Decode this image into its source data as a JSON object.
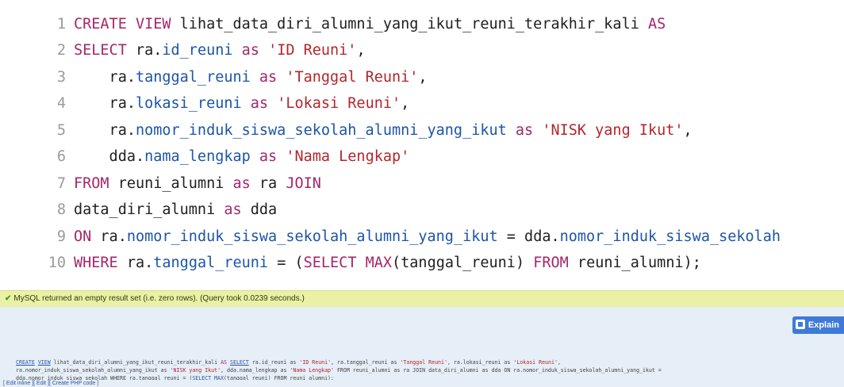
{
  "editor": {
    "lines": [
      {
        "num": "1",
        "tokens": [
          {
            "t": "kw",
            "v": "CREATE VIEW"
          },
          {
            "t": "plain",
            "v": " lihat_data_diri_alumni_yang_ikut_reuni_terakhir_kali "
          },
          {
            "t": "kw",
            "v": "AS"
          }
        ]
      },
      {
        "num": "2",
        "tokens": [
          {
            "t": "kw",
            "v": "SELECT"
          },
          {
            "t": "plain",
            "v": " ra."
          },
          {
            "t": "fld",
            "v": "id_reuni"
          },
          {
            "t": "kw",
            "v": " as "
          },
          {
            "t": "str",
            "v": "'ID Reuni'"
          },
          {
            "t": "plain",
            "v": ","
          }
        ]
      },
      {
        "num": "3",
        "tokens": [
          {
            "t": "plain",
            "v": "    ra."
          },
          {
            "t": "fld",
            "v": "tanggal_reuni"
          },
          {
            "t": "kw",
            "v": " as "
          },
          {
            "t": "str",
            "v": "'Tanggal Reuni'"
          },
          {
            "t": "plain",
            "v": ","
          }
        ]
      },
      {
        "num": "4",
        "tokens": [
          {
            "t": "plain",
            "v": "    ra."
          },
          {
            "t": "fld",
            "v": "lokasi_reuni"
          },
          {
            "t": "kw",
            "v": " as "
          },
          {
            "t": "str",
            "v": "'Lokasi Reuni'"
          },
          {
            "t": "plain",
            "v": ","
          }
        ]
      },
      {
        "num": "5",
        "tokens": [
          {
            "t": "plain",
            "v": "    ra."
          },
          {
            "t": "fld",
            "v": "nomor_induk_siswa_sekolah_alumni_yang_ikut"
          },
          {
            "t": "kw",
            "v": " as "
          },
          {
            "t": "str",
            "v": "'NISK yang Ikut'"
          },
          {
            "t": "plain",
            "v": ","
          }
        ]
      },
      {
        "num": "6",
        "tokens": [
          {
            "t": "plain",
            "v": "    dda."
          },
          {
            "t": "fld",
            "v": "nama_lengkap"
          },
          {
            "t": "kw",
            "v": " as "
          },
          {
            "t": "str",
            "v": "'Nama Lengkap'"
          }
        ]
      },
      {
        "num": "7",
        "tokens": [
          {
            "t": "kw",
            "v": "FROM"
          },
          {
            "t": "plain",
            "v": " reuni_alumni "
          },
          {
            "t": "kw",
            "v": "as"
          },
          {
            "t": "plain",
            "v": " ra "
          },
          {
            "t": "kw",
            "v": "JOIN"
          }
        ]
      },
      {
        "num": "8",
        "tokens": [
          {
            "t": "plain",
            "v": "data_diri_alumni "
          },
          {
            "t": "kw",
            "v": "as"
          },
          {
            "t": "plain",
            "v": " dda"
          }
        ]
      },
      {
        "num": "9",
        "tokens": [
          {
            "t": "kw",
            "v": "ON"
          },
          {
            "t": "plain",
            "v": " ra."
          },
          {
            "t": "fld",
            "v": "nomor_induk_siswa_sekolah_alumni_yang_ikut"
          },
          {
            "t": "plain",
            "v": " = dda."
          },
          {
            "t": "fld",
            "v": "nomor_induk_siswa_sekolah"
          }
        ]
      },
      {
        "num": "10",
        "tokens": [
          {
            "t": "kw",
            "v": "WHERE"
          },
          {
            "t": "plain",
            "v": " ra."
          },
          {
            "t": "fld",
            "v": "tanggal_reuni"
          },
          {
            "t": "plain",
            "v": " = ("
          },
          {
            "t": "kw",
            "v": "SELECT MAX"
          },
          {
            "t": "plain",
            "v": "(tanggal_reuni) "
          },
          {
            "t": "kw",
            "v": "FROM"
          },
          {
            "t": "plain",
            "v": " reuni_alumni);"
          }
        ]
      }
    ]
  },
  "status": {
    "message": "MySQL returned an empty result set (i.e. zero rows). (Query took 0.0239 seconds.)"
  },
  "result": {
    "explain_label": "Explain",
    "echo_lines": [
      [
        {
          "t": "a",
          "v": "CREATE"
        },
        {
          "t": "p",
          "v": " "
        },
        {
          "t": "a",
          "v": "VIEW"
        },
        {
          "t": "p",
          "v": " lihat_data_diri_alumni_yang_ikut_reuni_terakhir_kali "
        },
        {
          "t": "k",
          "v": "AS"
        },
        {
          "t": "p",
          "v": " "
        },
        {
          "t": "a",
          "v": "SELECT"
        },
        {
          "t": "p",
          "v": " ra.id_reuni as "
        },
        {
          "t": "s",
          "v": "'ID Reuni'"
        },
        {
          "t": "p",
          "v": ", ra.tanggal_reuni as "
        },
        {
          "t": "s",
          "v": "'Tanggal Reuni'"
        },
        {
          "t": "p",
          "v": ", ra.lokasi_reuni as "
        },
        {
          "t": "s",
          "v": "'Lokasi Reuni'"
        },
        {
          "t": "p",
          "v": ","
        }
      ],
      [
        {
          "t": "p",
          "v": "ra.nomor_induk_siswa_sekolah_alumni_yang_ikut as "
        },
        {
          "t": "s",
          "v": "'NISK yang Ikut'"
        },
        {
          "t": "p",
          "v": ", dda.nama_lengkap as "
        },
        {
          "t": "s",
          "v": "'Nama Lengkap'"
        },
        {
          "t": "p",
          "v": " FROM reuni_alumni as ra JOIN data_diri_alumni as dda ON ra.nomor_induk_siswa_sekolah_alumni_yang_ikut ="
        }
      ],
      [
        {
          "t": "p",
          "v": "dda.nomor_induk_siswa_sekolah WHERE ra.tanggal_reuni = ("
        },
        {
          "t": "a",
          "v": "SELECT"
        },
        {
          "t": "p",
          "v": " "
        },
        {
          "t": "a",
          "v": "MAX"
        },
        {
          "t": "p",
          "v": "(tanggal_reuni) FROM reuni_alumni);"
        }
      ]
    ],
    "links": [
      "[ Edit inline ]",
      "[ Edit ]",
      "[ Create PHP code ]"
    ]
  }
}
